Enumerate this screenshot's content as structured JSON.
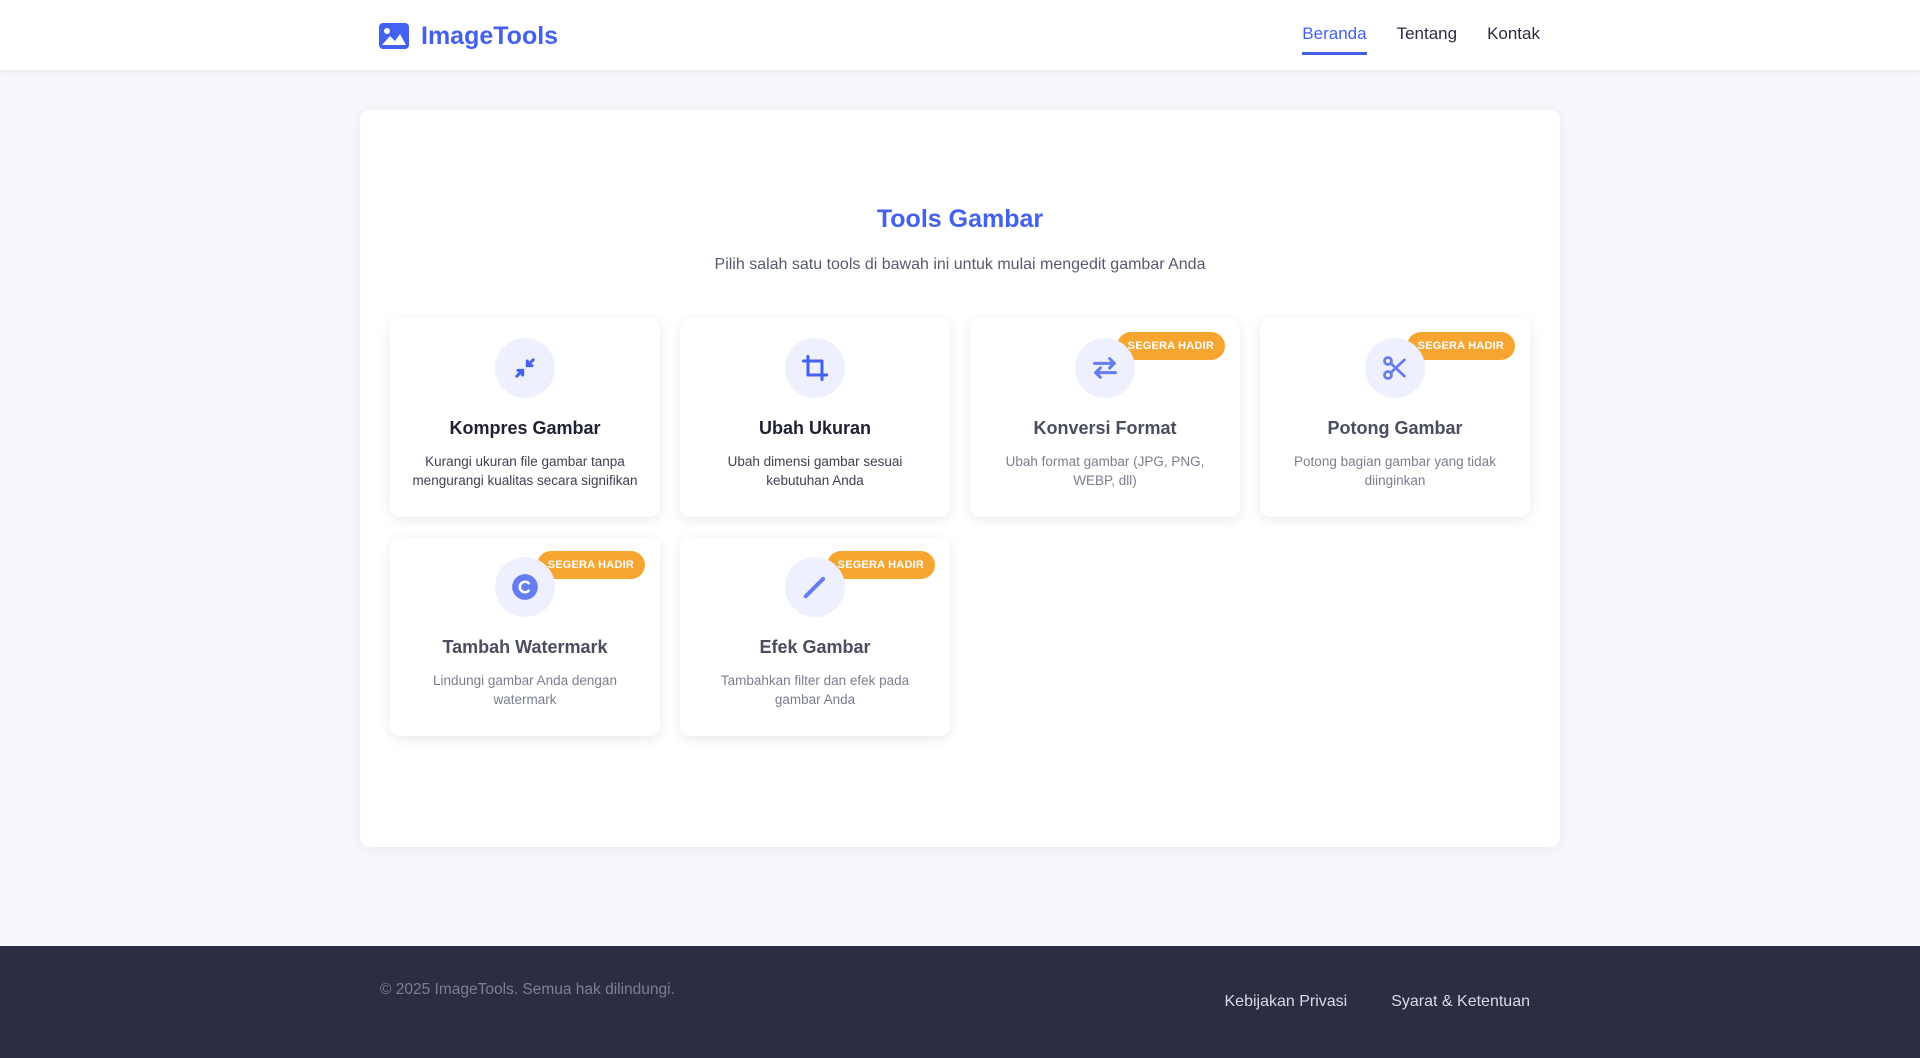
{
  "header": {
    "logo_text": "ImageTools",
    "logo_icon": "image-icon",
    "nav": [
      {
        "label": "Beranda",
        "active": true
      },
      {
        "label": "Tentang",
        "active": false
      },
      {
        "label": "Kontak",
        "active": false
      }
    ]
  },
  "main": {
    "title": "Tools Gambar",
    "subtitle": "Pilih salah satu tools di bawah ini untuk mulai mengedit gambar Anda",
    "tools": [
      {
        "title": "Kompres Gambar",
        "description": "Kurangi ukuran file gambar tanpa mengurangi kualitas secara signifikan",
        "icon": "compress-icon",
        "badge": ""
      },
      {
        "title": "Ubah Ukuran",
        "description": "Ubah dimensi gambar sesuai kebutuhan Anda",
        "icon": "crop-icon",
        "badge": ""
      },
      {
        "title": "Konversi Format",
        "description": "Ubah format gambar (JPG, PNG, WEBP, dll)",
        "icon": "exchange-icon",
        "badge": "SEGERA HADIR"
      },
      {
        "title": "Potong Gambar",
        "description": "Potong bagian gambar yang tidak diinginkan",
        "icon": "scissors-icon",
        "badge": "SEGERA HADIR"
      },
      {
        "title": "Tambah Watermark",
        "description": "Lindungi gambar Anda dengan watermark",
        "icon": "copyright-icon",
        "badge": "SEGERA HADIR"
      },
      {
        "title": "Efek Gambar",
        "description": "Tambahkan filter dan efek pada gambar Anda",
        "icon": "magic-wand-icon",
        "badge": "SEGERA HADIR"
      }
    ]
  },
  "footer": {
    "copyright": "© 2025 ImageTools. Semua hak dilindungi.",
    "links": [
      "Kebijakan Privasi",
      "Syarat & Ketentuan"
    ]
  },
  "colors": {
    "accent": "#4361ee",
    "badge": "#f7a531",
    "footer_bg": "#2b2d42",
    "page_bg": "#f7f8fc"
  }
}
